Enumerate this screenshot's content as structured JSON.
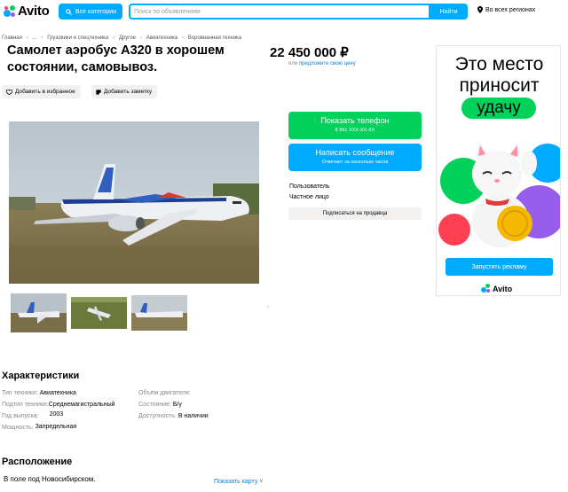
{
  "header": {
    "logo_text": "Avito",
    "categories_label": "Все категории",
    "search_placeholder": "Поиск по объявлениям",
    "search_button": "Найти",
    "region": "Во всех регионах"
  },
  "breadcrumbs": [
    "Главная",
    "...",
    "Грузовики и спецтехника",
    "Другое",
    "Авиатехника",
    "Воровнанная техника"
  ],
  "listing": {
    "title": "Самолет аэробус А320 в хорошем состоянии, самовывоз.",
    "price": "22 450 000 ₽",
    "price_hint_prefix": "или",
    "price_hint_link": "предложите свою цену",
    "favorite_label": "Добавить в избранное",
    "note_label": "Добавить заметку"
  },
  "contact": {
    "show_phone": "Показать телефон",
    "phone_masked": "8 961 XXX-XX-XX",
    "write_message": "Написать сообщение",
    "reply_time": "Отвечает за несколько часов",
    "seller_name": "Пользователь",
    "seller_type": "Частное лицо",
    "subscribe": "Подписаться на продавца"
  },
  "ad": {
    "line1": "Это место",
    "line2": "приносит",
    "line3": "удачу",
    "button": "Запустить рекламу",
    "brand": "Avito"
  },
  "characteristics": {
    "heading": "Характеристики",
    "items": [
      {
        "k": "Тип техники:",
        "v": "Авиатехника"
      },
      {
        "k": "Подтип техники:",
        "v": "Среднемагистральный"
      },
      {
        "k": "Год выпуска:",
        "v": "2003"
      },
      {
        "k": "Мощность:",
        "v": "Запредельная"
      },
      {
        "k": "Объём двигателя:",
        "v": ""
      },
      {
        "k": "Состояние:",
        "v": "Б/у"
      },
      {
        "k": "Доступность:",
        "v": "В наличии"
      }
    ]
  },
  "location": {
    "heading": "Расположение",
    "address": "В поле под Новосибирском.",
    "map_link": "Показать карту"
  },
  "colors": {
    "accent_blue": "#00aaff",
    "accent_green": "#02d15c",
    "link": "#0a7ed1"
  }
}
